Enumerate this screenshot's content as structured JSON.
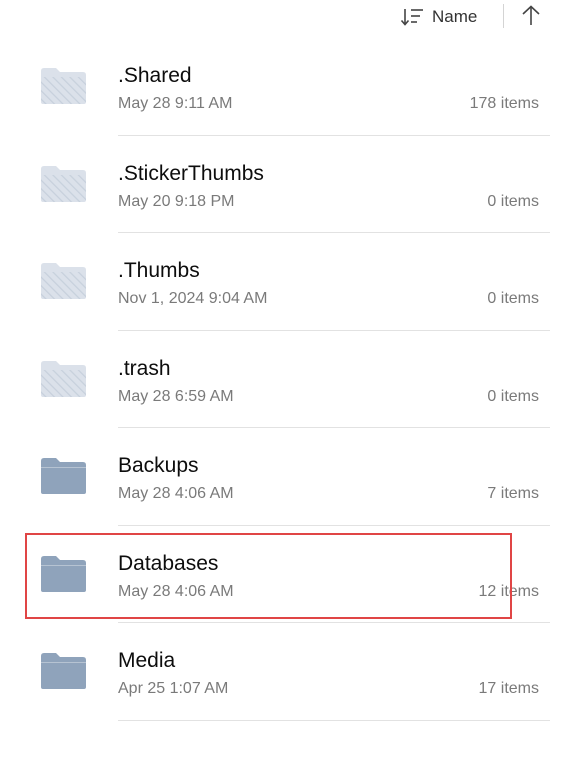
{
  "toolbar": {
    "sort_icon": "sort-lines-icon",
    "sort_label": "Name",
    "direction_icon": "arrow-up-icon"
  },
  "colors": {
    "hidden_folder": "#dbe1ea",
    "folder": "#8fa3bb",
    "highlight": "#e04545"
  },
  "items": [
    {
      "name": ".Shared",
      "date": "May 28 9:11 AM",
      "count": "178 items",
      "hidden": true
    },
    {
      "name": ".StickerThumbs",
      "date": "May 20 9:18 PM",
      "count": "0 items",
      "hidden": true
    },
    {
      "name": ".Thumbs",
      "date": "Nov 1, 2024 9:04 AM",
      "count": "0 items",
      "hidden": true
    },
    {
      "name": ".trash",
      "date": "May 28 6:59 AM",
      "count": "0 items",
      "hidden": true
    },
    {
      "name": "Backups",
      "date": "May 28 4:06 AM",
      "count": "7 items",
      "hidden": false
    },
    {
      "name": "Databases",
      "date": "May 28 4:06 AM",
      "count": "12 items",
      "hidden": false,
      "highlighted": true
    },
    {
      "name": "Media",
      "date": "Apr 25 1:07 AM",
      "count": "17 items",
      "hidden": false
    }
  ]
}
